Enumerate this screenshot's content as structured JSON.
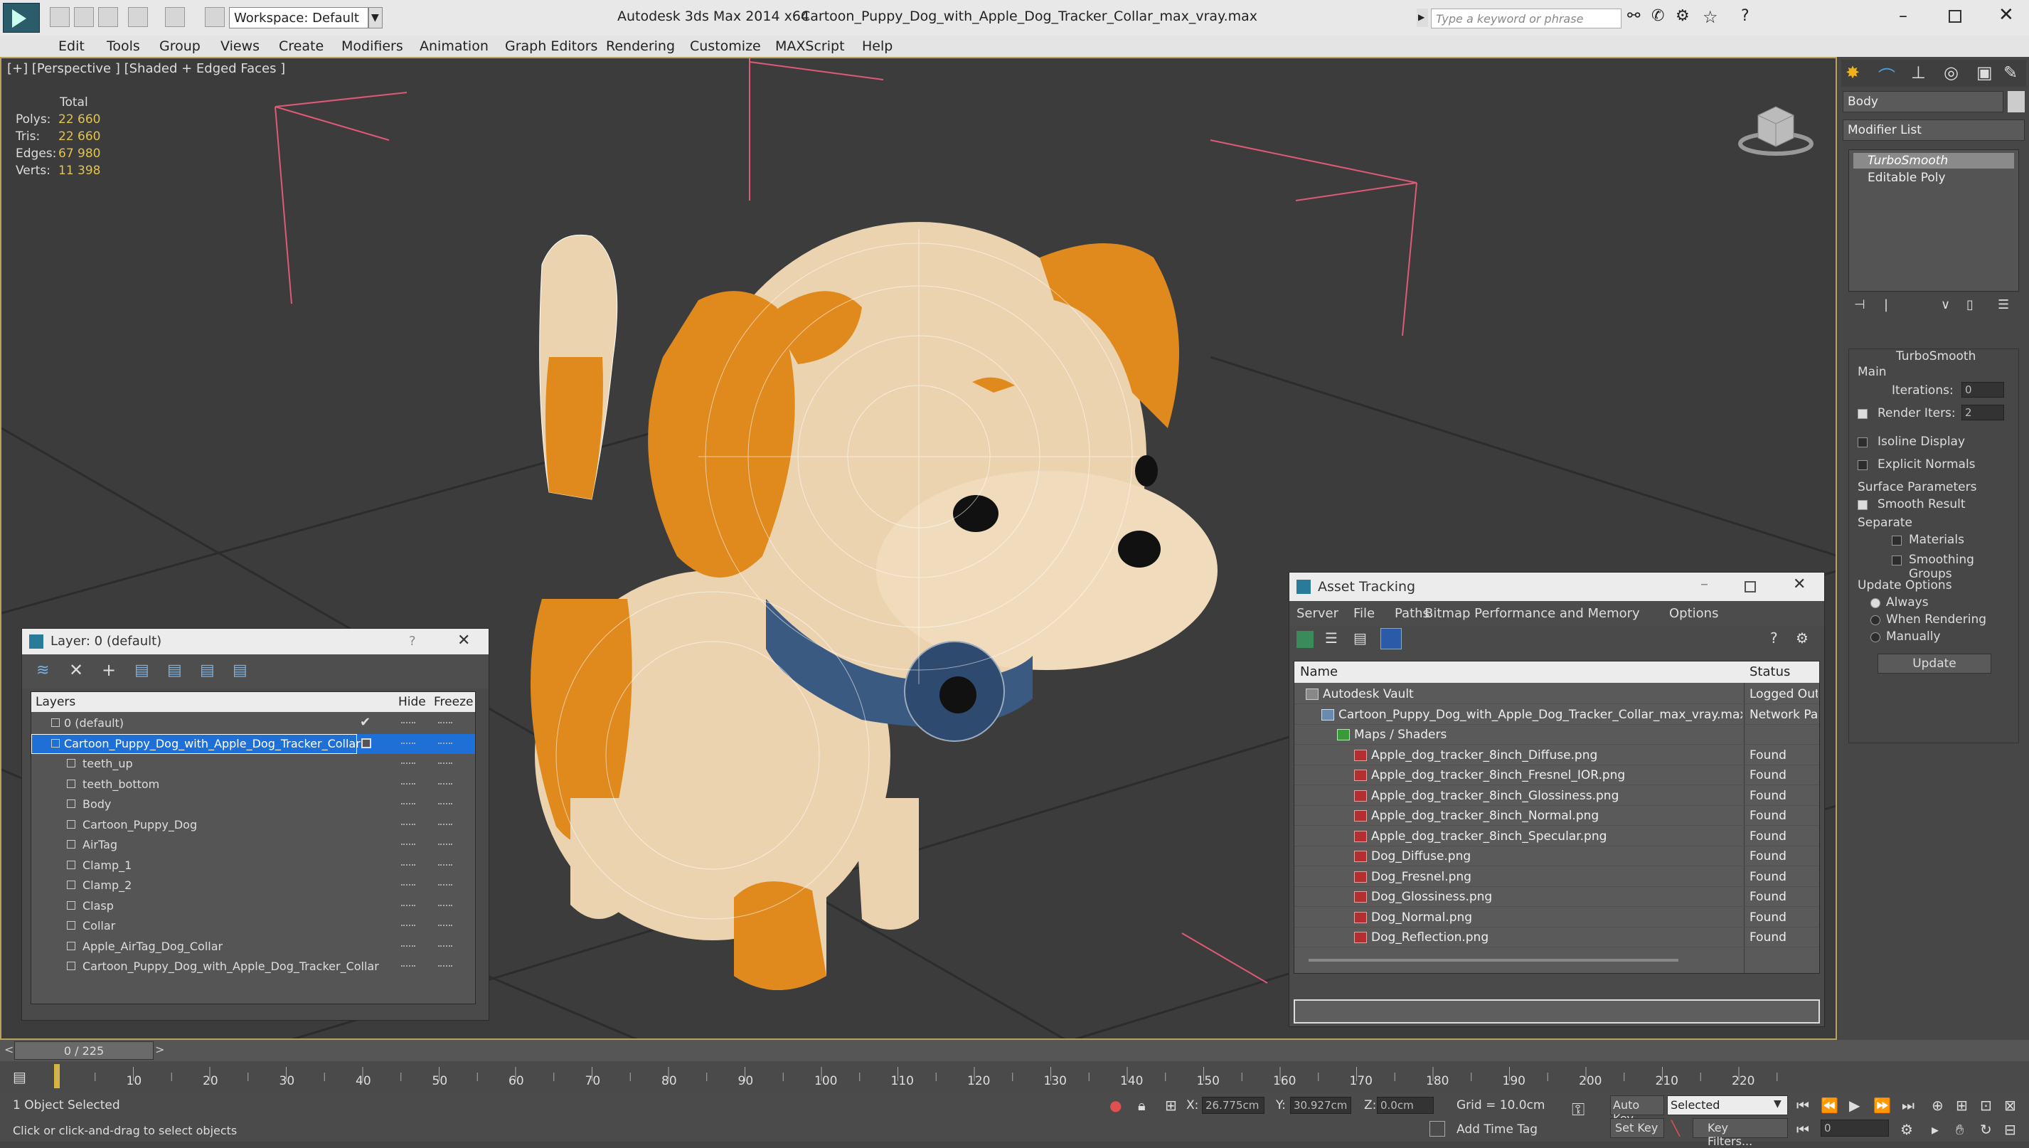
{
  "window": {
    "workspace_label": "Workspace: Default",
    "app_title": "Autodesk 3ds Max  2014 x64",
    "file_title": "Cartoon_Puppy_Dog_with_Apple_Dog_Tracker_Collar_max_vray.max",
    "search_placeholder": "Type a keyword or phrase"
  },
  "menu": [
    "Edit",
    "Tools",
    "Group",
    "Views",
    "Create",
    "Modifiers",
    "Animation",
    "Graph Editors",
    "Rendering",
    "Customize",
    "MAXScript",
    "Help"
  ],
  "viewport": {
    "label": "[+] [Perspective ] [Shaded + Edged Faces ]",
    "stats_header": "Total",
    "stats": [
      {
        "key": "Polys:",
        "value": "22 660"
      },
      {
        "key": "Tris:",
        "value": "22 660"
      },
      {
        "key": "Edges:",
        "value": "67 980"
      },
      {
        "key": "Verts:",
        "value": "11 398"
      }
    ]
  },
  "command_panel": {
    "object_name": "Body",
    "modifier_list": "Modifier List",
    "stack": [
      "TurboSmooth",
      "Editable Poly"
    ],
    "rollout_title": "TurboSmooth",
    "main": "Main",
    "iterations_label": "Iterations:",
    "iterations_value": "0",
    "render_iters_label": "Render Iters:",
    "render_iters_value": "2",
    "isoline": "Isoline Display",
    "explicit_normals": "Explicit Normals",
    "surface_params": "Surface Parameters",
    "smooth_result": "Smooth Result",
    "separate": "Separate",
    "materials": "Materials",
    "smoothing_groups": "Smoothing Groups",
    "update_options": "Update Options",
    "always": "Always",
    "when_rendering": "When Rendering",
    "manually": "Manually",
    "update_button": "Update"
  },
  "layer_window": {
    "title": "Layer: 0 (default)",
    "help": "?",
    "col_layers": "Layers",
    "col_hide": "Hide",
    "col_freeze": "Freeze",
    "rows": [
      {
        "name": "0 (default)",
        "indent": 0,
        "selected": false
      },
      {
        "name": "Cartoon_Puppy_Dog_with_Apple_Dog_Tracker_Collar",
        "indent": 0,
        "selected": true
      },
      {
        "name": "teeth_up",
        "indent": 1,
        "selected": false
      },
      {
        "name": "teeth_bottom",
        "indent": 1,
        "selected": false
      },
      {
        "name": "Body",
        "indent": 1,
        "selected": false
      },
      {
        "name": "Cartoon_Puppy_Dog",
        "indent": 1,
        "selected": false
      },
      {
        "name": "AirTag",
        "indent": 1,
        "selected": false
      },
      {
        "name": "Clamp_1",
        "indent": 1,
        "selected": false
      },
      {
        "name": "Clamp_2",
        "indent": 1,
        "selected": false
      },
      {
        "name": "Clasp",
        "indent": 1,
        "selected": false
      },
      {
        "name": "Collar",
        "indent": 1,
        "selected": false
      },
      {
        "name": "Apple_AirTag_Dog_Collar",
        "indent": 1,
        "selected": false
      },
      {
        "name": "Cartoon_Puppy_Dog_with_Apple_Dog_Tracker_Collar",
        "indent": 1,
        "selected": false
      }
    ]
  },
  "asset_window": {
    "title": "Asset Tracking",
    "menu": [
      "Server",
      "File",
      "Paths",
      "Bitmap Performance and Memory",
      "Options"
    ],
    "col_name": "Name",
    "col_status": "Status",
    "rows": [
      {
        "name": "Autodesk Vault",
        "status": "Logged Out",
        "level": 0,
        "kind": "vault"
      },
      {
        "name": "Cartoon_Puppy_Dog_with_Apple_Dog_Tracker_Collar_max_vray.max",
        "status": "Network Path",
        "level": 1,
        "kind": "max"
      },
      {
        "name": "Maps / Shaders",
        "status": "",
        "level": 2,
        "kind": "folder"
      },
      {
        "name": "Apple_dog_tracker_8inch_Diffuse.png",
        "status": "Found",
        "level": 3,
        "kind": "png"
      },
      {
        "name": "Apple_dog_tracker_8inch_Fresnel_IOR.png",
        "status": "Found",
        "level": 3,
        "kind": "png"
      },
      {
        "name": "Apple_dog_tracker_8inch_Glossiness.png",
        "status": "Found",
        "level": 3,
        "kind": "png"
      },
      {
        "name": "Apple_dog_tracker_8inch_Normal.png",
        "status": "Found",
        "level": 3,
        "kind": "png"
      },
      {
        "name": "Apple_dog_tracker_8inch_Specular.png",
        "status": "Found",
        "level": 3,
        "kind": "png"
      },
      {
        "name": "Dog_Diffuse.png",
        "status": "Found",
        "level": 3,
        "kind": "png"
      },
      {
        "name": "Dog_Fresnel.png",
        "status": "Found",
        "level": 3,
        "kind": "png"
      },
      {
        "name": "Dog_Glossiness.png",
        "status": "Found",
        "level": 3,
        "kind": "png"
      },
      {
        "name": "Dog_Normal.png",
        "status": "Found",
        "level": 3,
        "kind": "png"
      },
      {
        "name": "Dog_Reflection.png",
        "status": "Found",
        "level": 3,
        "kind": "png"
      }
    ]
  },
  "timeline": {
    "frame_counter": "0 / 225",
    "ticks": [
      "10",
      "20",
      "30",
      "40",
      "50",
      "60",
      "70",
      "80",
      "90",
      "100",
      "110",
      "120",
      "130",
      "140",
      "150",
      "160",
      "170",
      "180",
      "190",
      "200",
      "210",
      "220"
    ]
  },
  "status": {
    "selection": "1 Object Selected",
    "prompt": "Click or click-and-drag to select objects",
    "x_label": "X:",
    "x_value": "26.775cm",
    "y_label": "Y:",
    "y_value": "30.927cm",
    "z_label": "Z:",
    "z_value": "0.0cm",
    "grid": "Grid = 10.0cm",
    "auto_key": "Auto Key",
    "set_key": "Set Key",
    "selected_dropdown": "Selected",
    "key_filters": "Key Filters...",
    "add_time_tag": "Add Time Tag",
    "frame_value": "0"
  },
  "colors": {
    "viewport_bg": "#3c3c3c",
    "accent_orange": "#e08a1e",
    "body_cream": "#ecd3b0",
    "collar_blue": "#3a5a82",
    "stat_value": "#e4c34a",
    "selection_blue": "#1e70d6"
  }
}
